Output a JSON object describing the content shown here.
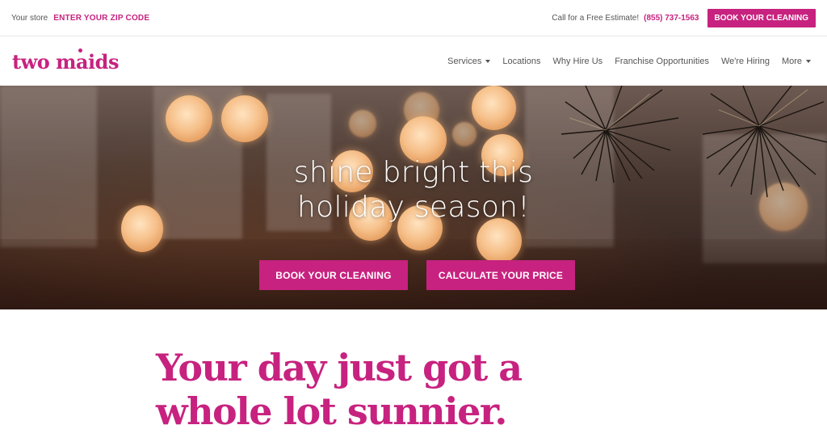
{
  "topbar": {
    "store_label": "Your store",
    "zip_link": "ENTER YOUR ZIP CODE",
    "estimate_text": "Call for a Free Estimate!",
    "phone": "(855) 737-1563",
    "book_button": "BOOK YOUR CLEANING"
  },
  "brand": {
    "logo_text": "two maids",
    "accent_color": "#c7227f"
  },
  "nav": {
    "items": [
      {
        "label": "Services",
        "has_dropdown": true
      },
      {
        "label": "Locations",
        "has_dropdown": false
      },
      {
        "label": "Why Hire Us",
        "has_dropdown": false
      },
      {
        "label": "Franchise Opportunities",
        "has_dropdown": false
      },
      {
        "label": "We're Hiring",
        "has_dropdown": false
      },
      {
        "label": "More",
        "has_dropdown": true
      }
    ]
  },
  "hero": {
    "title_line1": "shine bright this",
    "title_line2": "holiday season!",
    "book_button": "BOOK YOUR CLEANING",
    "calc_button": "CALCULATE YOUR PRICE"
  },
  "main": {
    "headline_line1": "Your day just got a",
    "headline_line2": "whole lot sunnier."
  }
}
